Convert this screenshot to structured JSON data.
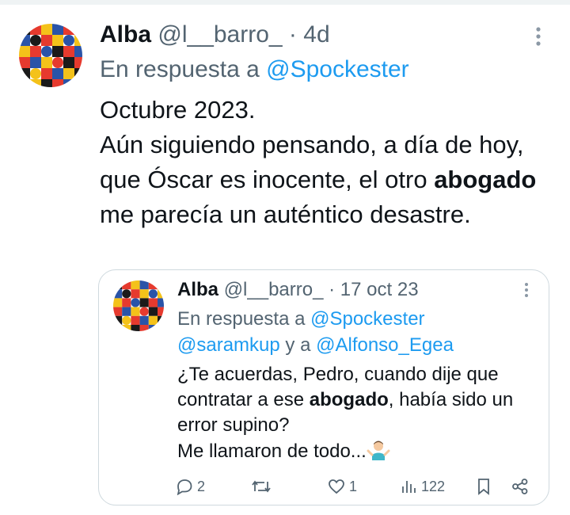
{
  "tweet": {
    "name": "Alba",
    "handle": "@l__barro_",
    "separator": "·",
    "time": "4d",
    "reply_prefix": "En respuesta a ",
    "reply_to": "@Spockester",
    "text_line1": "Octubre 2023.",
    "text_part1": "Aún siguiendo pensando, a día de hoy, que Óscar es inocente, el otro ",
    "text_bold": "abogado",
    "text_part2": " me parecía un auténtico desastre."
  },
  "quoted": {
    "name": "Alba",
    "handle": "@l__barro_",
    "separator": "·",
    "time": "17 oct 23",
    "reply_prefix": "En respuesta a ",
    "reply_to_1": "@Spockester",
    "reply_to_2": "@saramkup",
    "reply_and": " y a ",
    "reply_to_3": "@Alfonso_Egea",
    "text_part1": "¿Te acuerdas, Pedro, cuando dije que contratar a ese ",
    "text_bold": "abogado",
    "text_part2": ", había sido un error supino?",
    "text_line2": "Me llamaron de todo...",
    "emoji": "man-shrugging-emoji",
    "actions": {
      "replies": "2",
      "retweets": "",
      "likes": "1",
      "views": "122"
    }
  },
  "icons": [
    "more-options-icon",
    "reply-icon",
    "retweet-icon",
    "like-icon",
    "views-icon",
    "bookmark-icon",
    "share-icon"
  ],
  "colors": {
    "link": "#1d9bf0",
    "muted": "#536471",
    "text": "#0f1419",
    "border": "#cfd9de"
  }
}
